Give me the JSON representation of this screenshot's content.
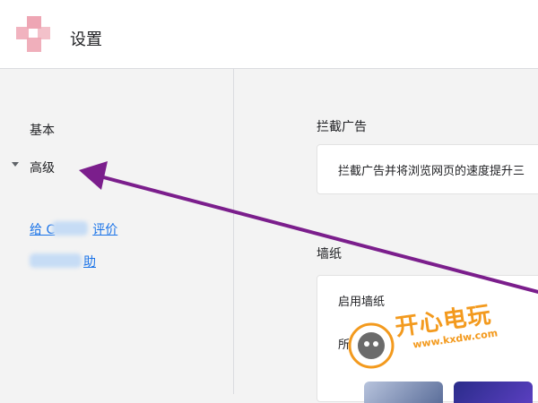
{
  "header": {
    "title": "设置"
  },
  "sidebar": {
    "items": [
      {
        "label": "基本"
      },
      {
        "label": "高级"
      }
    ],
    "links": [
      {
        "prefix": "给 C",
        "suffix": "评价"
      },
      {
        "prefix": "",
        "suffix": "助"
      }
    ]
  },
  "main": {
    "sections": [
      {
        "title": "拦截广告",
        "description": "拦截广告并将浏览网页的速度提升三"
      },
      {
        "title": "墙纸",
        "toggle_label": "启用墙纸",
        "sub_label": "所"
      }
    ]
  },
  "watermark": {
    "text": "开心电玩",
    "subtext": "www.kxdw.com"
  },
  "colors": {
    "accent": "#1a73e8",
    "arrow": "#7b1e8c",
    "watermark": "#f39a1e"
  }
}
